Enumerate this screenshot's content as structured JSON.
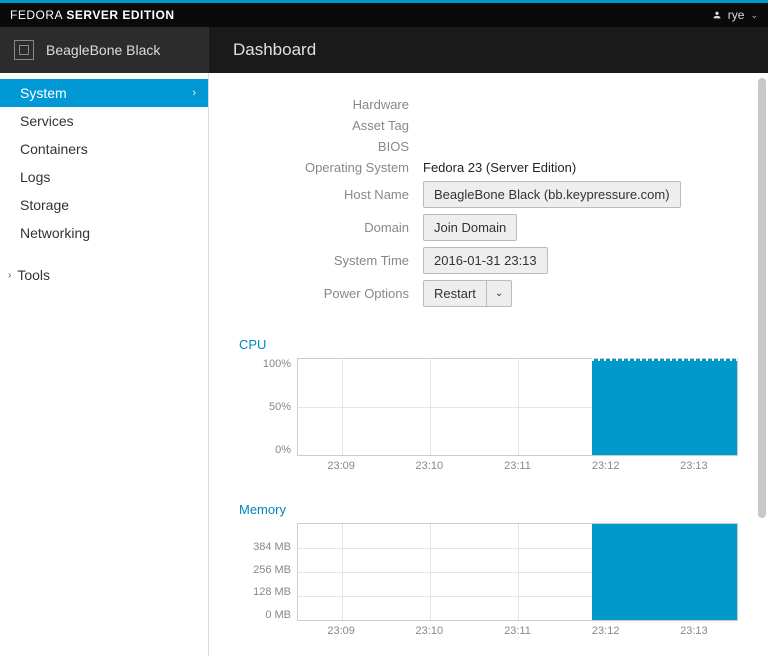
{
  "brand": {
    "light": "FEDORA",
    "bold": "SERVER EDITION"
  },
  "user": {
    "name": "rye"
  },
  "host": {
    "name": "BeagleBone Black"
  },
  "page_title": "Dashboard",
  "sidebar": {
    "items": [
      {
        "label": "System",
        "active": true
      },
      {
        "label": "Services"
      },
      {
        "label": "Containers"
      },
      {
        "label": "Logs"
      },
      {
        "label": "Storage"
      },
      {
        "label": "Networking"
      }
    ],
    "tools_label": "Tools"
  },
  "info": {
    "labels": {
      "hardware": "Hardware",
      "asset_tag": "Asset Tag",
      "bios": "BIOS",
      "os": "Operating System",
      "hostname": "Host Name",
      "domain": "Domain",
      "systime": "System Time",
      "power": "Power Options"
    },
    "values": {
      "hardware": "",
      "asset_tag": "",
      "bios": "",
      "os": "Fedora 23 (Server Edition)",
      "hostname": "BeagleBone Black (bb.keypressure.com)",
      "domain_btn": "Join Domain",
      "systime": "2016-01-31 23:13",
      "power_btn": "Restart"
    }
  },
  "chart_data": [
    {
      "type": "area",
      "title": "CPU",
      "ylabel": "",
      "y_ticks": [
        "100%",
        "50%",
        "0%"
      ],
      "x_ticks": [
        "23:09",
        "23:10",
        "23:11",
        "23:12",
        "23:13"
      ],
      "ylim": [
        0,
        100
      ],
      "series": [
        {
          "name": "cpu",
          "x": [
            "23:08:30",
            "23:11:50",
            "23:11:51",
            "23:13:30"
          ],
          "values": [
            0,
            0,
            100,
            100
          ]
        }
      ],
      "note": "CPU usage ~0% until roughly 23:11:50, then ~100% sustained"
    },
    {
      "type": "area",
      "title": "Memory",
      "ylabel": "",
      "y_ticks": [
        "384 MB",
        "256 MB",
        "128 MB",
        "0 MB"
      ],
      "x_ticks": [
        "23:09",
        "23:10",
        "23:11",
        "23:12",
        "23:13"
      ],
      "ylim": [
        0,
        512
      ],
      "series": [
        {
          "name": "mem",
          "x": [
            "23:08:30",
            "23:11:50",
            "23:11:51",
            "23:13:30"
          ],
          "values": [
            0,
            0,
            500,
            500
          ]
        }
      ],
      "note": "Memory ~0 until roughly 23:11:50, then ~500 MB (off-scale) sustained"
    }
  ]
}
